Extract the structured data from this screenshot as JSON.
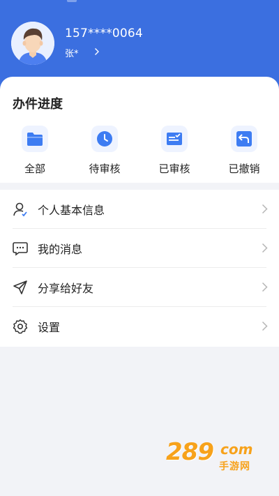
{
  "header": {
    "phone": "157****0064",
    "name": "张*",
    "background_color": "#3b6fe0"
  },
  "progress": {
    "title": "办件进度",
    "items": [
      {
        "label": "全部",
        "icon": "folder-icon"
      },
      {
        "label": "待审核",
        "icon": "clock-icon"
      },
      {
        "label": "已审核",
        "icon": "checked-list-icon"
      },
      {
        "label": "已撤销",
        "icon": "undo-icon"
      }
    ],
    "icon_color": "#3d7cf2"
  },
  "menu": {
    "items": [
      {
        "label": "个人基本信息",
        "icon": "person-icon"
      },
      {
        "label": "我的消息",
        "icon": "message-icon"
      },
      {
        "label": "分享给好友",
        "icon": "share-icon"
      },
      {
        "label": "设置",
        "icon": "settings-icon"
      }
    ]
  },
  "watermark": {
    "number": "289",
    "domain": "com",
    "subtitle": "手游网"
  }
}
